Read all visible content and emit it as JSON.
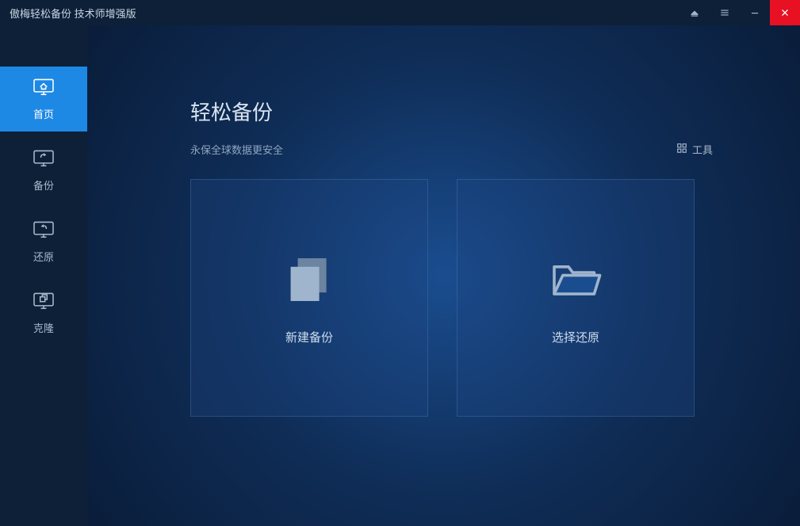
{
  "titlebar": {
    "title": "傲梅轻松备份 技术师增强版"
  },
  "sidebar": {
    "items": [
      {
        "label": "首页"
      },
      {
        "label": "备份"
      },
      {
        "label": "还原"
      },
      {
        "label": "克隆"
      }
    ]
  },
  "main": {
    "title": "轻松备份",
    "subtitle": "永保全球数据更安全",
    "tools_label": "工具"
  },
  "cards": {
    "new_backup": {
      "label": "新建备份"
    },
    "select_restore": {
      "label": "选择还原"
    }
  }
}
